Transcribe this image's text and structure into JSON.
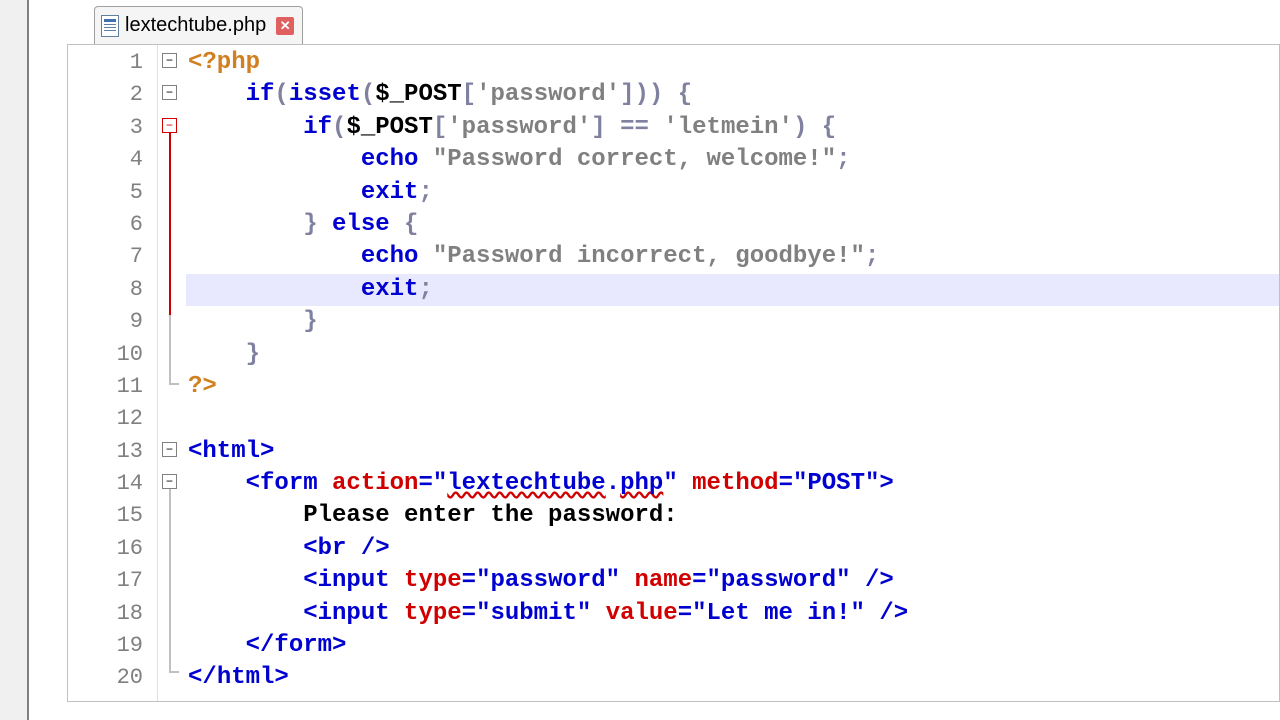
{
  "tab": {
    "filename": "lextechtube.php",
    "close": "✕"
  },
  "editor": {
    "highlighted_line": 8,
    "lines": [
      {
        "n": 1
      },
      {
        "n": 2
      },
      {
        "n": 3
      },
      {
        "n": 4
      },
      {
        "n": 5
      },
      {
        "n": 6
      },
      {
        "n": 7
      },
      {
        "n": 8
      },
      {
        "n": 9
      },
      {
        "n": 10
      },
      {
        "n": 11
      },
      {
        "n": 12
      },
      {
        "n": 13
      },
      {
        "n": 14
      },
      {
        "n": 15
      },
      {
        "n": 16
      },
      {
        "n": 17
      },
      {
        "n": 18
      },
      {
        "n": 19
      },
      {
        "n": 20
      }
    ],
    "code": {
      "l1": {
        "open": "<?php"
      },
      "l2": {
        "if": "if",
        "isset": "isset",
        "post": "$_POST",
        "key": "'password'"
      },
      "l3": {
        "if": "if",
        "post": "$_POST",
        "key": "'password'",
        "eq": "==",
        "val": "'letmein'"
      },
      "l4": {
        "echo": "echo",
        "str": "\"Password correct, welcome!\""
      },
      "l5": {
        "exit": "exit"
      },
      "l6": {
        "else": "else"
      },
      "l7": {
        "echo": "echo",
        "str": "\"Password incorrect, goodbye!\""
      },
      "l8": {
        "exit": "exit"
      },
      "l11": {
        "close": "?>"
      },
      "l13": {
        "tag": "html"
      },
      "l14": {
        "tag": "form",
        "a1": "action",
        "v1a": "lextechtube",
        "v1b": ".",
        "v1c": "php",
        "a2": "method",
        "v2": "\"POST\""
      },
      "l15": {
        "txt": "Please enter the password:"
      },
      "l16": {
        "tag": "br"
      },
      "l17": {
        "tag": "input",
        "a1": "type",
        "v1": "\"password\"",
        "a2": "name",
        "v2": "\"password\""
      },
      "l18": {
        "tag": "input",
        "a1": "type",
        "v1": "\"submit\"",
        "a2": "value",
        "v2": "\"Let me in!\""
      },
      "l19": {
        "tag": "form"
      },
      "l20": {
        "tag": "html"
      }
    }
  }
}
